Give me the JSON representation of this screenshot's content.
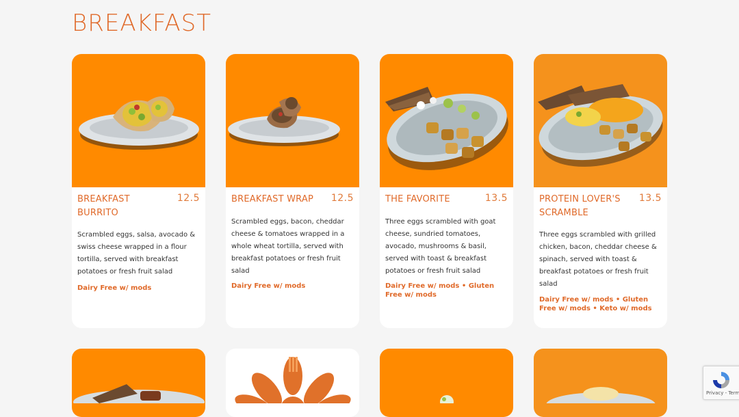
{
  "section": {
    "title": "BREAKFAST"
  },
  "items": [
    {
      "name": "BREAKFAST BURRITO",
      "price": "12.5",
      "description": "Scrambled eggs, salsa, avocado & swiss cheese wrapped in a flour tortilla, served with breakfast potatoes or fresh fruit salad",
      "dietary": "Dairy Free w/ mods"
    },
    {
      "name": "BREAKFAST WRAP",
      "price": "12.5",
      "description": "Scrambled eggs, bacon, cheddar cheese & tomatoes wrapped in a whole wheat tortilla, served with breakfast potatoes or fresh fruit salad",
      "dietary": "Dairy Free w/ mods"
    },
    {
      "name": "THE FAVORITE",
      "price": "13.5",
      "description": "Three eggs scrambled with goat cheese, sundried tomatoes, avocado, mushrooms & basil, served with toast & breakfast potatoes or fresh fruit salad",
      "dietary": "Dairy Free w/ mods • Gluten Free w/ mods"
    },
    {
      "name": "PROTEIN LOVER'S SCRAMBLE",
      "price": "13.5",
      "description": "Three eggs scrambled with grilled chicken, bacon, cheddar cheese & spinach, served with toast & breakfast potatoes or fresh fruit salad",
      "dietary": "Dairy Free w/ mods • Gluten Free w/ mods • Keto w/ mods"
    }
  ],
  "recaptcha": {
    "links": "Privacy - Terms"
  },
  "colors": {
    "accent": "#e06a2a",
    "card_bg": "#ff8a00",
    "page_bg": "#f5f5f5"
  }
}
